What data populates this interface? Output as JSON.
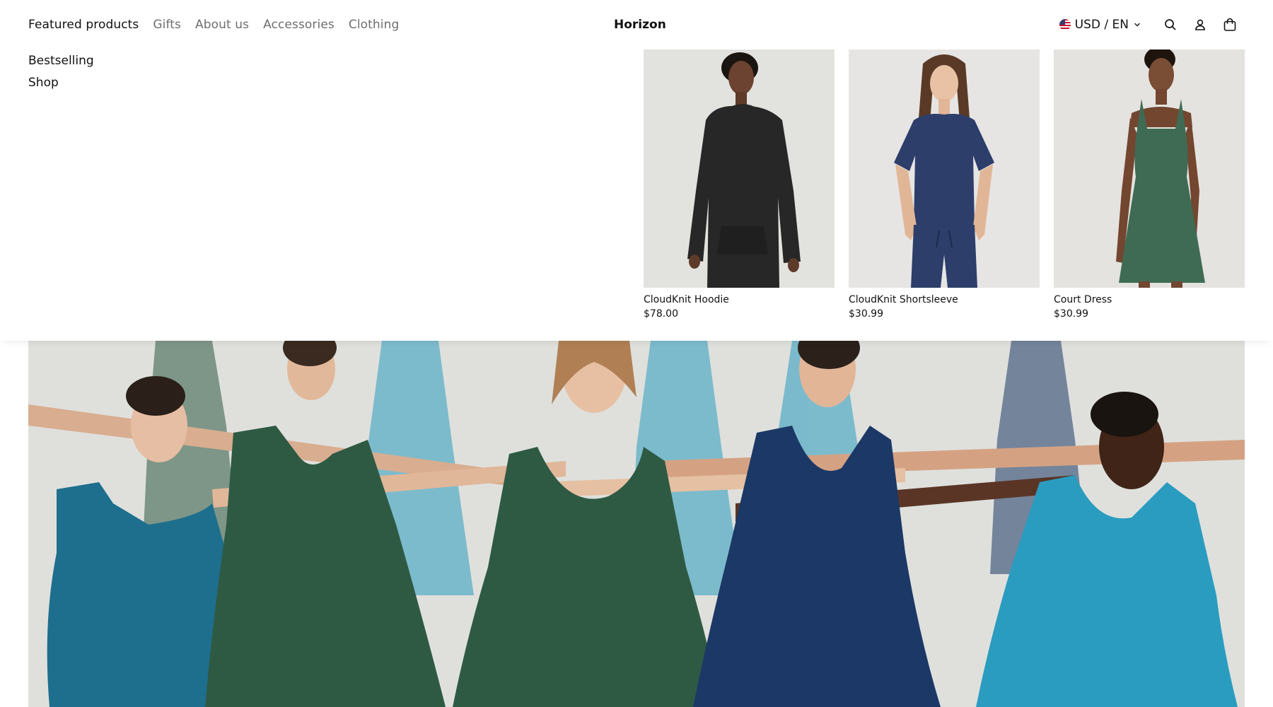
{
  "header": {
    "nav": [
      {
        "label": "Featured products",
        "active": true
      },
      {
        "label": "Gifts",
        "active": false
      },
      {
        "label": "About us",
        "active": false
      },
      {
        "label": "Accessories",
        "active": false
      },
      {
        "label": "Clothing",
        "active": false
      }
    ],
    "logo": "Horizon",
    "locale": {
      "label": "USD / EN",
      "flag_icon": "us-flag-icon"
    },
    "icons": [
      "search-icon",
      "account-icon",
      "cart-icon"
    ]
  },
  "mega_menu": {
    "links": [
      "Bestselling",
      "Shop"
    ],
    "products": [
      {
        "name": "CloudKnit Hoodie",
        "price": "$78.00",
        "garment_color": "#262726"
      },
      {
        "name": "CloudKnit Shortsleeve",
        "price": "$30.99",
        "garment_color": "#2d3e6b"
      },
      {
        "name": "Court Dress",
        "price": "$30.99",
        "garment_color": "#3f6b55"
      }
    ]
  },
  "hero": {
    "background_color": "#dfe0dc",
    "dress_colors": [
      "#1e6f8e",
      "#2e5a44",
      "#1b3866",
      "#2a9cbf"
    ]
  }
}
